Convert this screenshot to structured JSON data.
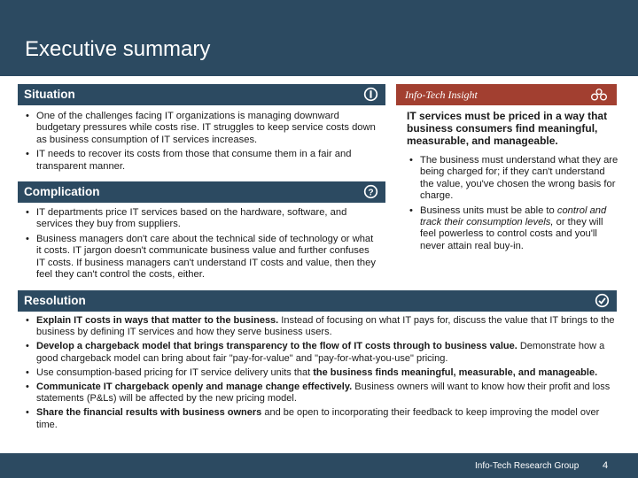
{
  "header": {
    "title": "Executive summary"
  },
  "situation": {
    "title": "Situation",
    "icon": "info-icon",
    "bullets": [
      "One of the challenges facing IT organizations is managing downward budgetary pressures while costs rise. IT struggles to keep service costs down as business consumption of IT services increases.",
      "IT needs to recover its costs from those that consume them in a fair and transparent manner."
    ]
  },
  "complication": {
    "title": "Complication",
    "icon": "question-icon",
    "bullets": [
      "IT departments price IT services based on the hardware, software, and services they buy from suppliers.",
      "Business managers don't care about the technical side of technology or what it costs. IT jargon doesn't communicate business value and further confuses IT costs. If business managers can't understand IT costs and value, then they feel they can't control the costs, either."
    ]
  },
  "insight": {
    "title": "Info-Tech Insight",
    "icon": "gears-icon",
    "lead": "IT services must be priced in a way that business consumers find meaningful, measurable, and manageable.",
    "bullets": [
      {
        "text": "The business must understand what they are being charged for; if they can't understand the value, you've chosen the wrong basis for charge."
      },
      {
        "pre": "Business units must be able to ",
        "italic": "control and track their consumption levels,",
        "post": " or they will feel powerless to control costs and you'll never attain real buy-in."
      }
    ]
  },
  "resolution": {
    "title": "Resolution",
    "icon": "check-circle-icon",
    "bullets": [
      {
        "bold": "Explain IT costs in ways that matter to the business.",
        "text": " Instead of focusing on what IT pays for, discuss the value that IT brings to the business by defining IT services and how they serve business users."
      },
      {
        "bold": "Develop a chargeback model that brings transparency to the flow of IT costs through to business value.",
        "text": " Demonstrate how a good chargeback model can bring about fair \"pay-for-value\" and \"pay-for-what-you-use\" pricing."
      },
      {
        "pre": "Use consumption-based pricing for IT service delivery units that ",
        "bold": "the business finds meaningful, measurable, and manageable."
      },
      {
        "bold": "Communicate IT chargeback openly and manage change effectively.",
        "text": " Business owners will want to know how their profit and loss statements (P&Ls) will be affected by the new pricing model."
      },
      {
        "bold": "Share the financial results with business owners",
        "text": " and be open to incorporating their feedback to keep improving the model over time."
      }
    ]
  },
  "footer": {
    "org": "Info-Tech Research Group",
    "page": "4"
  },
  "colors": {
    "navy": "#2c4a61",
    "insight_red": "#a23f30"
  }
}
